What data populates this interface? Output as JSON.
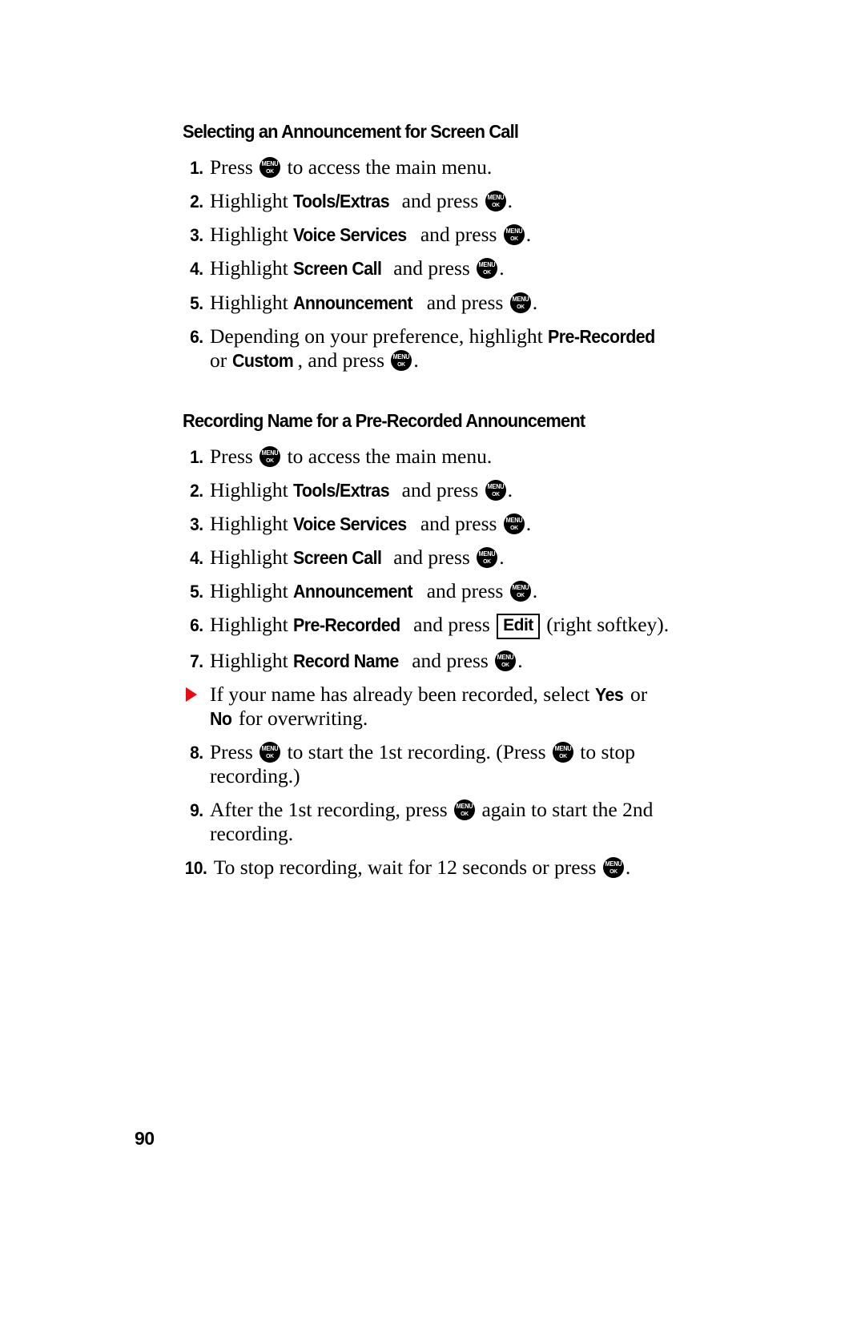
{
  "document": {
    "page_number": "90",
    "key_icon": {
      "name": "menu-ok-key-icon",
      "line1": "MENU",
      "line2": "OK"
    },
    "bullet_color": "#ea0a13"
  },
  "sections": [
    {
      "heading": "Selecting an Announcement for Screen Call",
      "steps": [
        {
          "number": "1.",
          "parts": [
            {
              "type": "text",
              "value": "Press "
            },
            {
              "type": "key"
            },
            {
              "type": "text",
              "value": " to access the main menu."
            }
          ]
        },
        {
          "number": "2.",
          "parts": [
            {
              "type": "text",
              "value": "Highlight "
            },
            {
              "type": "ui",
              "value": "Tools/Extras"
            },
            {
              "type": "text",
              "value": " and press "
            },
            {
              "type": "key"
            },
            {
              "type": "text",
              "value": "."
            }
          ]
        },
        {
          "number": "3.",
          "parts": [
            {
              "type": "text",
              "value": "Highlight "
            },
            {
              "type": "ui",
              "value": "Voice Services"
            },
            {
              "type": "text",
              "value": " and press "
            },
            {
              "type": "key"
            },
            {
              "type": "text",
              "value": "."
            }
          ]
        },
        {
          "number": "4.",
          "parts": [
            {
              "type": "text",
              "value": "Highlight "
            },
            {
              "type": "ui",
              "value": "Screen Call"
            },
            {
              "type": "text",
              "value": " and press "
            },
            {
              "type": "key"
            },
            {
              "type": "text",
              "value": "."
            }
          ]
        },
        {
          "number": "5.",
          "parts": [
            {
              "type": "text",
              "value": "Highlight "
            },
            {
              "type": "ui",
              "value": "Announcement"
            },
            {
              "type": "text",
              "value": " and press "
            },
            {
              "type": "key"
            },
            {
              "type": "text",
              "value": "."
            }
          ]
        },
        {
          "number": "6.",
          "parts": [
            {
              "type": "text",
              "value": "Depending on your preference, highlight "
            },
            {
              "type": "ui",
              "value": "Pre-Recorded"
            },
            {
              "type": "text",
              "value": " or "
            },
            {
              "type": "ui",
              "value": "Custom"
            },
            {
              "type": "text",
              "value": ", and press "
            },
            {
              "type": "key"
            },
            {
              "type": "text",
              "value": "."
            }
          ]
        }
      ]
    },
    {
      "heading": "Recording Name for a Pre-Recorded Announcement",
      "steps": [
        {
          "number": "1.",
          "parts": [
            {
              "type": "text",
              "value": "Press "
            },
            {
              "type": "key"
            },
            {
              "type": "text",
              "value": " to access the main menu."
            }
          ]
        },
        {
          "number": "2.",
          "parts": [
            {
              "type": "text",
              "value": "Highlight "
            },
            {
              "type": "ui",
              "value": "Tools/Extras"
            },
            {
              "type": "text",
              "value": " and press "
            },
            {
              "type": "key"
            },
            {
              "type": "text",
              "value": "."
            }
          ]
        },
        {
          "number": "3.",
          "parts": [
            {
              "type": "text",
              "value": "Highlight "
            },
            {
              "type": "ui",
              "value": "Voice Services"
            },
            {
              "type": "text",
              "value": " and press "
            },
            {
              "type": "key"
            },
            {
              "type": "text",
              "value": "."
            }
          ]
        },
        {
          "number": "4.",
          "parts": [
            {
              "type": "text",
              "value": "Highlight "
            },
            {
              "type": "ui",
              "value": "Screen Call"
            },
            {
              "type": "text",
              "value": " and press "
            },
            {
              "type": "key"
            },
            {
              "type": "text",
              "value": "."
            }
          ]
        },
        {
          "number": "5.",
          "parts": [
            {
              "type": "text",
              "value": "Highlight "
            },
            {
              "type": "ui",
              "value": "Announcement"
            },
            {
              "type": "text",
              "value": " and press "
            },
            {
              "type": "key"
            },
            {
              "type": "text",
              "value": "."
            }
          ]
        },
        {
          "number": "6.",
          "parts": [
            {
              "type": "text",
              "value": "Highlight "
            },
            {
              "type": "ui",
              "value": "Pre-Recorded"
            },
            {
              "type": "text",
              "value": " and press "
            },
            {
              "type": "softkey",
              "value": "Edit"
            },
            {
              "type": "text",
              "value": " (right softkey)."
            }
          ]
        },
        {
          "number": "7.",
          "parts": [
            {
              "type": "text",
              "value": "Highlight "
            },
            {
              "type": "ui",
              "value": "Record Name"
            },
            {
              "type": "text",
              "value": " and press "
            },
            {
              "type": "key"
            },
            {
              "type": "text",
              "value": "."
            }
          ]
        },
        {
          "number": "bullet",
          "parts": [
            {
              "type": "text",
              "value": "If your name has already been recorded, select "
            },
            {
              "type": "ui",
              "value": "Yes"
            },
            {
              "type": "text",
              "value": " or "
            },
            {
              "type": "ui",
              "value": "No"
            },
            {
              "type": "text",
              "value": " for overwriting."
            }
          ]
        },
        {
          "number": "8.",
          "parts": [
            {
              "type": "text",
              "value": "Press "
            },
            {
              "type": "key"
            },
            {
              "type": "text",
              "value": " to start the 1st recording. (Press "
            },
            {
              "type": "key"
            },
            {
              "type": "text",
              "value": " to stop recording.)"
            }
          ]
        },
        {
          "number": "9.",
          "parts": [
            {
              "type": "text",
              "value": "After the 1st recording, press "
            },
            {
              "type": "key"
            },
            {
              "type": "text",
              "value": " again to start the 2nd recording."
            }
          ]
        },
        {
          "number": "10.",
          "parts": [
            {
              "type": "text",
              "value": "To stop recording, wait for 12 seconds or press "
            },
            {
              "type": "key"
            },
            {
              "type": "text",
              "value": "."
            }
          ]
        }
      ]
    }
  ]
}
